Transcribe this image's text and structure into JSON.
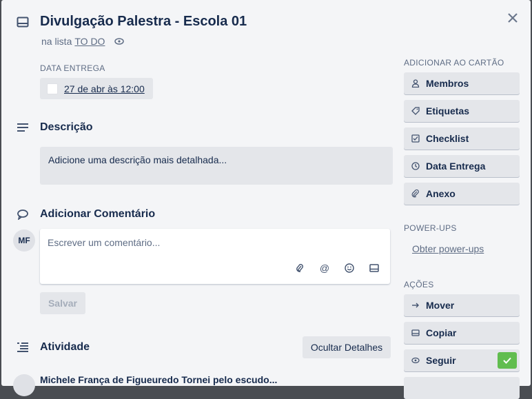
{
  "card": {
    "title": "Divulgação Palestra - Escola 01",
    "list_prefix": "na lista",
    "list_name": "TO DO"
  },
  "due": {
    "label": "DATA ENTREGA",
    "value": "27 de abr às 12:00"
  },
  "description": {
    "heading": "Descrição",
    "placeholder": "Adicione uma descrição mais detalhada..."
  },
  "comment": {
    "heading": "Adicionar Comentário",
    "avatar_initials": "MF",
    "placeholder": "Escrever um comentário...",
    "save_label": "Salvar"
  },
  "activity": {
    "heading": "Atividade",
    "toggle_label": "Ocultar Detalhes",
    "first_entry": "Michele França de Figueuredo  Tornei pelo escudo..."
  },
  "sidebar": {
    "add_label": "ADICIONAR AO CARTÃO",
    "add_items": [
      {
        "label": "Membros",
        "icon": "person-icon"
      },
      {
        "label": "Etiquetas",
        "icon": "tag-icon"
      },
      {
        "label": "Checklist",
        "icon": "checklist-icon"
      },
      {
        "label": "Data Entrega",
        "icon": "clock-icon"
      },
      {
        "label": "Anexo",
        "icon": "paperclip-icon"
      }
    ],
    "powerups_label": "POWER-UPS",
    "powerups_link": "Obter power-ups",
    "actions_label": "AÇÕES",
    "action_items": [
      {
        "label": "Mover",
        "icon": "arrow-right-icon"
      },
      {
        "label": "Copiar",
        "icon": "card-icon"
      },
      {
        "label": "Seguir",
        "icon": "eye-icon",
        "checked": true
      }
    ]
  },
  "colors": {
    "accent_green": "#61bd4f",
    "text_primary": "#172b4d",
    "text_secondary": "#5e6c84",
    "button_bg": "#e4e6ea"
  }
}
